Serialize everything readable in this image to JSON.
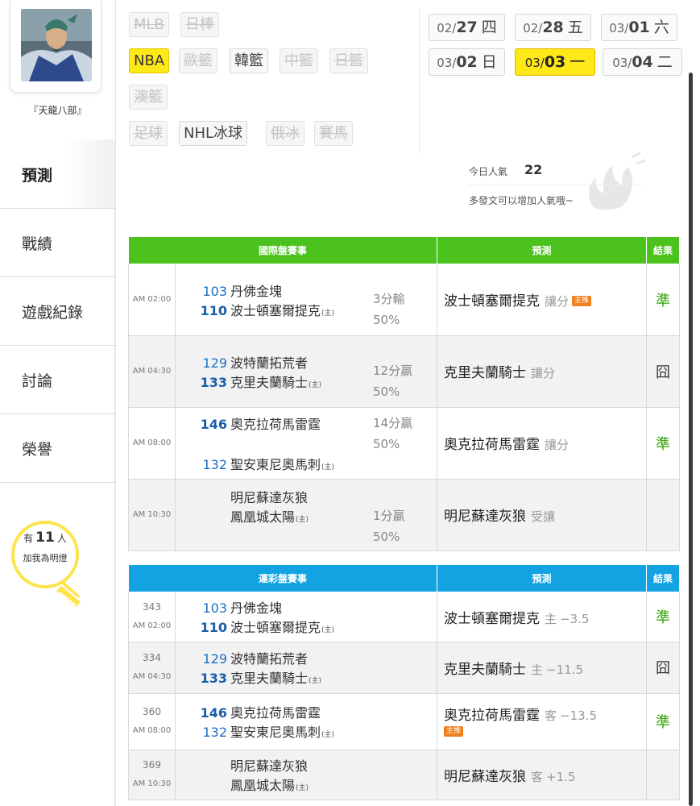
{
  "user": {
    "name": "『天龍八部』"
  },
  "nav": [
    "預測",
    "戰績",
    "遊戲紀錄",
    "討論",
    "榮譽"
  ],
  "bulb": {
    "prefix": "有",
    "count": "11",
    "suffix": "人",
    "line2": "加我為明燈"
  },
  "leagues": {
    "row1": [
      {
        "label": "MLB",
        "state": "disabled"
      },
      {
        "label": "日棒",
        "state": "disabled"
      }
    ],
    "row2": [
      {
        "label": "NBA",
        "state": "selected"
      },
      {
        "label": "歐籃",
        "state": "disabled"
      },
      {
        "label": "韓籃",
        "state": "enabled"
      },
      {
        "label": "中籃",
        "state": "disabled"
      },
      {
        "label": "日籃",
        "state": "disabled"
      }
    ],
    "row3": [
      {
        "label": "澳籃",
        "state": "disabled"
      }
    ],
    "row4": [
      {
        "label": "足球",
        "state": "disabled"
      },
      {
        "label": "NHL冰球",
        "state": "enabled"
      },
      {
        "label": "俄冰",
        "state": "disabled"
      },
      {
        "label": "賽馬",
        "state": "disabled"
      }
    ]
  },
  "dates": [
    {
      "month": "02/",
      "day": "27",
      "weekday": "四"
    },
    {
      "month": "02/",
      "day": "28",
      "weekday": "五"
    },
    {
      "month": "03/",
      "day": "01",
      "weekday": "六"
    },
    {
      "month": "03/",
      "day": "02",
      "weekday": "日"
    },
    {
      "month": "03/",
      "day": "03",
      "weekday": "一"
    },
    {
      "month": "03/",
      "day": "04",
      "weekday": "二"
    }
  ],
  "selected_date": "03/03",
  "popularity": {
    "label": "今日人氣",
    "value": "22",
    "hint": "多發文可以增加人氣哦~"
  },
  "international": {
    "headers": [
      "國際盤賽事",
      "預測",
      "結果"
    ],
    "rows": [
      {
        "time": "AM 02:00",
        "away_score": "103",
        "away": "丹佛金塊",
        "home_score": "110",
        "home": "波士頓塞爾提克",
        "home_tag": "(主)",
        "margin": "3分輸",
        "pct": "50%",
        "pick": "波士頓塞爾提克",
        "pick_type": "讓分",
        "badge": "主推",
        "result": "準"
      },
      {
        "time": "AM 04:30",
        "away_score": "129",
        "away": "波特蘭拓荒者",
        "home_score": "133",
        "home": "克里夫蘭騎士",
        "home_tag": "(主)",
        "margin": "12分贏",
        "pct": "50%",
        "pick": "克里夫蘭騎士",
        "pick_type": "讓分",
        "badge": "",
        "result": "囧"
      },
      {
        "time": "AM 08:00",
        "away_score": "146",
        "away": "奧克拉荷馬雷霆",
        "home_score": "132",
        "home": "聖安東尼奧馬刺",
        "home_tag": "(主)",
        "margin": "14分贏",
        "pct": "50%",
        "pick": "奧克拉荷馬雷霆",
        "pick_type": "讓分",
        "badge": "",
        "result": "準"
      },
      {
        "time": "AM 10:30",
        "away_score": "",
        "away": "明尼蘇達灰狼",
        "home_score": "",
        "home": "鳳凰城太陽",
        "home_tag": "(主)",
        "margin": "1分贏",
        "pct": "50%",
        "pick": "明尼蘇達灰狼",
        "pick_type": "受讓",
        "badge": "",
        "result": ""
      }
    ]
  },
  "sportslottery": {
    "headers": [
      "運彩盤賽事",
      "預測",
      "結果"
    ],
    "rows": [
      {
        "code": "343",
        "time": "AM 02:00",
        "away_score": "103",
        "away": "丹佛金塊",
        "home_score": "110",
        "home": "波士頓塞爾提克",
        "home_tag": "(主)",
        "pick": "波士頓塞爾提克",
        "pick_side": "主",
        "line": "−3.5",
        "badge": "",
        "result": "準"
      },
      {
        "code": "334",
        "time": "AM 04:30",
        "away_score": "129",
        "away": "波特蘭拓荒者",
        "home_score": "133",
        "home": "克里夫蘭騎士",
        "home_tag": "(主)",
        "pick": "克里夫蘭騎士",
        "pick_side": "主",
        "line": "−11.5",
        "badge": "",
        "result": "囧"
      },
      {
        "code": "360",
        "time": "AM 08:00",
        "away_score": "146",
        "away": "奧克拉荷馬雷霆",
        "home_score": "132",
        "home": "聖安東尼奧馬刺",
        "home_tag": "(主)",
        "pick": "奧克拉荷馬雷霆",
        "pick_side": "客",
        "line": "−13.5",
        "badge": "主推",
        "result": "準"
      },
      {
        "code": "369",
        "time": "AM 10:30",
        "away_score": "",
        "away": "明尼蘇達灰狼",
        "home_score": "",
        "home": "鳳凰城太陽",
        "home_tag": "(主)",
        "pick": "明尼蘇達灰狼",
        "pick_side": "客",
        "line": "+1.5",
        "badge": "",
        "result": ""
      }
    ]
  },
  "colors": {
    "green_header": "#4cc21e",
    "blue_header": "#13a3e3",
    "selected": "#ffe817",
    "correct": "#2da300",
    "badge": "#f2801e"
  }
}
